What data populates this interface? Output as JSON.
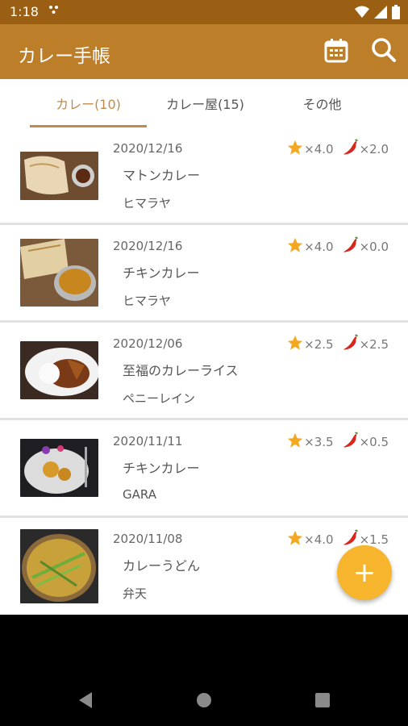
{
  "status_bar": {
    "time": "1:18"
  },
  "app_bar": {
    "title": "カレー手帳",
    "actions": [
      "calendar-icon",
      "search-icon"
    ]
  },
  "tabs": [
    {
      "label": "カレー(10)",
      "active": true
    },
    {
      "label": "カレー屋(15)",
      "active": false
    },
    {
      "label": "その他",
      "active": false
    }
  ],
  "entries": [
    {
      "date": "2020/12/16",
      "name": "マトンカレー",
      "shop": "ヒマラヤ",
      "rating": "×4.0",
      "spice": "×2.0"
    },
    {
      "date": "2020/12/16",
      "name": "チキンカレー",
      "shop": "ヒマラヤ",
      "rating": "×4.0",
      "spice": "×0.0"
    },
    {
      "date": "2020/12/06",
      "name": "至福のカレーライス",
      "shop": "ペニーレイン",
      "rating": "×2.5",
      "spice": "×2.5"
    },
    {
      "date": "2020/11/11",
      "name": "チキンカレー",
      "shop": "GARA",
      "rating": "×3.5",
      "spice": "×0.5"
    },
    {
      "date": "2020/11/08",
      "name": "カレーうどん",
      "shop": "弁天",
      "rating": "×4.0",
      "spice": "×1.5"
    }
  ],
  "fab": {
    "label": "+"
  },
  "colors": {
    "app_bar": "#bd7e2a",
    "status_bar": "#9a5f12",
    "accent": "#c08a4c",
    "fab": "#f6b52c",
    "star": "#f4a821",
    "chili": "#d8261c"
  }
}
